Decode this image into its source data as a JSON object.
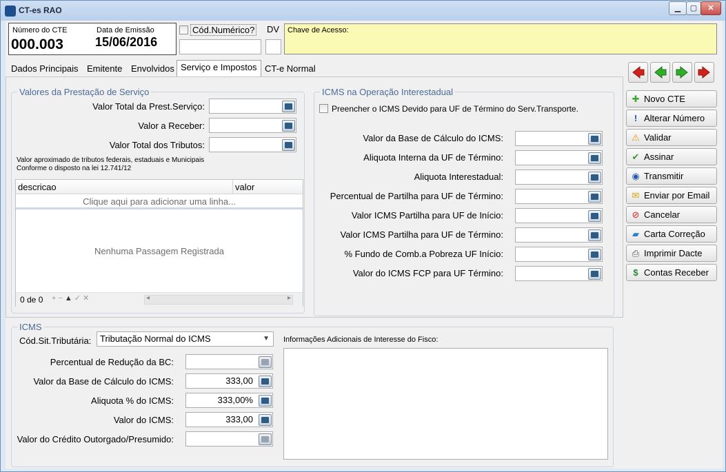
{
  "window": {
    "title": "CT-es RAO",
    "app_icon_text": "RAO"
  },
  "header": {
    "numero_label": "Número do CTE",
    "numero_value": "000.003",
    "data_label": "Data de Emissão",
    "data_value": "15/06/2016",
    "cod_numerico_label": "Cód.Numérico?",
    "cod_numerico_value": "",
    "dv_label": "DV",
    "dv_value": "",
    "chave_label": "Chave de Acesso:",
    "chave_value": ""
  },
  "tabs": [
    {
      "label": "Dados Principais"
    },
    {
      "label": "Emitente"
    },
    {
      "label": "Envolvidos"
    },
    {
      "label": "Serviço e Impostos"
    },
    {
      "label": "CT-e Normal"
    }
  ],
  "valores": {
    "title": "Valores da Prestação de Serviço",
    "fields": [
      {
        "label": "Valor Total da Prest.Serviço:",
        "value": ""
      },
      {
        "label": "Valor a Receber:",
        "value": ""
      },
      {
        "label": "Valor Total dos Tributos:",
        "value": ""
      }
    ],
    "note_line1": "Valor aproximado de tributos federais, estaduais e Municipais",
    "note_line2": "Conforme o disposto na lei 12.741/12",
    "grid": {
      "columns": [
        "descricao",
        "valor"
      ],
      "add_row_text": "Clique aqui para adicionar uma linha...",
      "empty_text": "Nenhuma Passagem Registrada",
      "record_count": "0 de 0",
      "nav_buttons": [
        "+",
        "−",
        "▲",
        "✓",
        "✕"
      ]
    }
  },
  "icms_interestadual": {
    "title": "ICMS na Operação Interestadual",
    "checkbox_label": "Preencher o ICMS Devido para UF de Término do Serv.Transporte.",
    "fields": [
      {
        "label": "Valor da Base de Cálculo do ICMS:",
        "value": ""
      },
      {
        "label": "Aliquota Interna da UF de Término:",
        "value": ""
      },
      {
        "label": "Aliquota Interestadual:",
        "value": ""
      },
      {
        "label": "Percentual de Partilha para UF de Término:",
        "value": ""
      },
      {
        "label": "Valor ICMS Partilha para UF de Início:",
        "value": ""
      },
      {
        "label": "Valor ICMS Partilha para UF de Término:",
        "value": ""
      },
      {
        "label": "% Fundo de Comb.a Pobreza UF Início:",
        "value": ""
      },
      {
        "label": "Valor do ICMS FCP para UF Término:",
        "value": ""
      }
    ]
  },
  "icms": {
    "title": "ICMS",
    "cst_label": "Cód.Sit.Tributária:",
    "cst_value": "Tributação Normal do ICMS",
    "fields": [
      {
        "label": "Percentual de Redução da BC:",
        "value": ""
      },
      {
        "label": "Valor da Base de Cálculo do ICMS:",
        "value": "333,00"
      },
      {
        "label": "Aliquota % do ICMS:",
        "value": "333,00%"
      },
      {
        "label": "Valor do ICMS:",
        "value": "333,00"
      },
      {
        "label": "Valor do Crédito Outorgado/Presumido:",
        "value": ""
      }
    ],
    "info_label": "Informações Adicionais de Interesse do Fisco:",
    "info_value": ""
  },
  "sidebar": {
    "buttons": [
      {
        "label": "Novo CTE",
        "icon": "plus-icon",
        "glyph": "✚",
        "color": "#3fa535"
      },
      {
        "label": "Alterar Número",
        "icon": "exclamation-icon",
        "glyph": "!",
        "color": "#1f4fb8"
      },
      {
        "label": "Validar",
        "icon": "warning-icon",
        "glyph": "⚠",
        "color": "#e49a12"
      },
      {
        "label": "Assinar",
        "icon": "check-icon",
        "glyph": "✔",
        "color": "#2e9a2e"
      },
      {
        "label": "Transmitir",
        "icon": "globe-icon",
        "glyph": "◉",
        "color": "#2a58b0"
      },
      {
        "label": "Enviar por Email",
        "icon": "envelope-icon",
        "glyph": "✉",
        "color": "#d9a400"
      },
      {
        "label": "Cancelar",
        "icon": "cancel-icon",
        "glyph": "⊘",
        "color": "#d42020"
      },
      {
        "label": "Carta Correção",
        "icon": "eraser-icon",
        "glyph": "▰",
        "color": "#2a7fc9"
      },
      {
        "label": "Imprimir Dacte",
        "icon": "printer-icon",
        "glyph": "⎙",
        "color": "#555555"
      },
      {
        "label": "Contas Receber",
        "icon": "dollar-icon",
        "glyph": "$",
        "color": "#2b8a2b"
      }
    ]
  }
}
